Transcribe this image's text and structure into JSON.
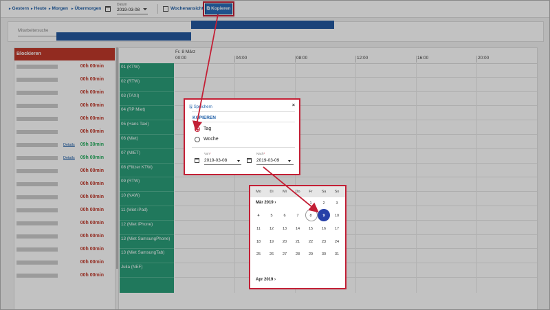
{
  "toolbar": {
    "gestern": "Gestern",
    "heute": "Heute",
    "morgen": "Morgen",
    "uebermorgen": "Übermorgen",
    "datum_label": "Datum",
    "datum_value": "2019-03-08",
    "wochenansicht": "Wochenansicht",
    "kopieren": "Kopieren"
  },
  "search": {
    "placeholder": "Mitarbeitersuche"
  },
  "left_panel": {
    "header": "Blockieren",
    "drivers": [
      {
        "hours": "00h 00min",
        "status": "red",
        "details": ""
      },
      {
        "hours": "00h 00min",
        "status": "red",
        "details": ""
      },
      {
        "hours": "00h 00min",
        "status": "red",
        "details": ""
      },
      {
        "hours": "00h 00min",
        "status": "red",
        "details": ""
      },
      {
        "hours": "00h 00min",
        "status": "red",
        "details": ""
      },
      {
        "hours": "00h 00min",
        "status": "red",
        "details": ""
      },
      {
        "hours": "09h 30min",
        "status": "green",
        "details": "Details"
      },
      {
        "hours": "09h 00min",
        "status": "green",
        "details": "Details"
      },
      {
        "hours": "00h 00min",
        "status": "red",
        "details": ""
      },
      {
        "hours": "00h 00min",
        "status": "red",
        "details": ""
      },
      {
        "hours": "00h 00min",
        "status": "red",
        "details": ""
      },
      {
        "hours": "00h 00min",
        "status": "red",
        "details": ""
      },
      {
        "hours": "00h 00min",
        "status": "red",
        "details": ""
      },
      {
        "hours": "00h 00min",
        "status": "red",
        "details": ""
      },
      {
        "hours": "00h 00min",
        "status": "red",
        "details": ""
      },
      {
        "hours": "00h 00min",
        "status": "red",
        "details": ""
      },
      {
        "hours": "00h 00min",
        "status": "red",
        "details": ""
      }
    ]
  },
  "calendar": {
    "day_label": "Fr. 8 März",
    "ticks": [
      "00:00",
      "04:00",
      "08:00",
      "12:00",
      "16:00",
      "20:00"
    ],
    "resources": [
      "01 (KTW)",
      "02 (RTW)",
      "03 (TAXI)",
      "04 (RP Miet)",
      "05 (Hans Taxi)",
      "06 (Miet)",
      "07 (MIET)",
      "08 (Flitzer KTW)",
      "09 (RTW)",
      "10 (NAW)",
      "11 (Miet iPad)",
      "12 (Miet iPhone)",
      "13 (Miet SamsungPhone)",
      "13 (Miet SamsungTab)",
      "Julia (NEF)"
    ]
  },
  "dialog": {
    "save": "Speichern",
    "close": "×",
    "title": "KOPIEREN",
    "options": [
      "Tag",
      "Woche"
    ],
    "selected": "Tag",
    "von_label": "Von",
    "von_value": "2019-03-08",
    "nach_label": "Nach",
    "nach_value": "2019-03-09"
  },
  "datepicker": {
    "weekdays": [
      "Mo",
      "Di",
      "Mi",
      "Do",
      "Fr",
      "Sa",
      "So"
    ],
    "month": "Mär 2019",
    "next_month": "Apr 2019",
    "today": "8",
    "selected": "9"
  },
  "colors": {
    "accent": "#2a6cb8",
    "highlight": "#c31f35",
    "resource": "#2b9e7a",
    "block_header": "#c0392b",
    "event": "#2459a0",
    "selected_day": "#2740a8"
  }
}
